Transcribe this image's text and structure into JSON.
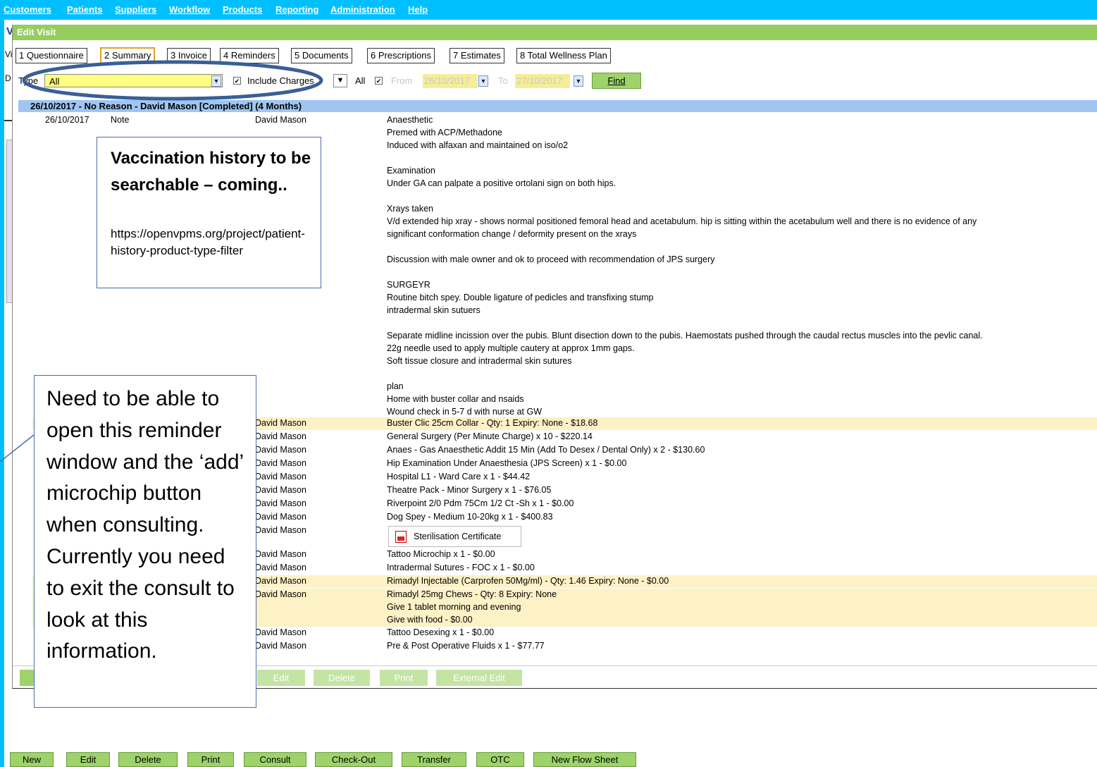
{
  "menu": [
    "Customers",
    "Patients",
    "Suppliers",
    "Workflow",
    "Products",
    "Reporting",
    "Administration",
    "Help"
  ],
  "window": {
    "title": "Edit Visit",
    "tabs": [
      "1 Questionnaire",
      "2 Summary",
      "3 Invoice",
      "4 Reminders",
      "5 Documents",
      "6 Prescriptions",
      "7 Estimates",
      "8 Total Wellness Plan"
    ],
    "filter": {
      "type_label": "Type",
      "type_value": "All",
      "include_charges_label": "Include Charges",
      "all_label": "All",
      "from_label": "From",
      "from_value": "26/10/2017",
      "to_label": "To",
      "to_value": "27/10/2017",
      "find_label": "Find"
    },
    "group_header": "26/10/2017 - No Reason - David Mason [Completed] (4 Months)",
    "first_row": {
      "date": "26/10/2017",
      "type": "Note",
      "clinician": "David Mason"
    },
    "note_lines": [
      "Anaesthetic",
      "Premed with ACP/Methadone",
      "Induced with alfaxan and maintained on iso/o2",
      "",
      "Examination",
      "Under GA can palpate a positive ortolani sign on both hips.",
      "",
      "Xrays taken",
      "V/d extended hip xray - shows normal positioned femoral head and acetabulum. hip is sitting within the acetabulum well and there is no evidence of any",
      "significant conformation change / deformity present on the xrays",
      "",
      "Discussion with male owner and ok to proceed with recommendation of JPS surgery",
      "",
      "SURGEYR",
      "Routine bitch spey. Double ligature of pedicles and transfixing stump",
      "intradermal skin sutuers",
      "",
      "Separate midline incission over the pubis. Blunt disection down to the pubis. Haemostats pushed through the caudal rectus muscles into the pevlic canal.",
      "22g needle used to apply multiple cautery at approx 1mm gaps.",
      "Soft tissue closure and intradermal skin sutures",
      "",
      "plan",
      "Home with buster collar and nsaids",
      "Wound check in 5-7 d with nurse at GW"
    ],
    "items": [
      {
        "clinician": "David Mason",
        "desc": "Buster Clic 25cm Collar - Qty: 1 Expiry: None - $18.68",
        "hl": true
      },
      {
        "clinician": "David Mason",
        "desc": "General Surgery (Per Minute Charge) x 10 - $220.14",
        "hl": false
      },
      {
        "clinician": "David Mason",
        "desc": "Anaes - Gas Anaesthetic Addit 15 Min (Add To Desex / Dental Only) x 2 - $130.60",
        "hl": false
      },
      {
        "clinician": "David Mason",
        "desc": "Hip Examination Under Anaesthesia (JPS Screen) x 1 - $0.00",
        "hl": false
      },
      {
        "clinician": "David Mason",
        "desc": "Hospital L1 - Ward Care x 1 - $44.42",
        "hl": false
      },
      {
        "clinician": "David Mason",
        "desc": "Theatre Pack - Minor Surgery x 1 - $76.05",
        "hl": false
      },
      {
        "clinician": "David Mason",
        "desc": "Riverpoint 2/0 Pdm 75Cm 1/2 Ct -Sh x 1 - $0.00",
        "hl": false
      },
      {
        "clinician": "David Mason",
        "desc": "Dog Spey - Medium 10-20kg x 1 - $400.83",
        "hl": false
      },
      {
        "clinician": "David Mason",
        "desc": "",
        "hl": false
      },
      {
        "clinician": "David Mason",
        "desc": "Tattoo Microchip x 1 - $0.00",
        "hl": false
      },
      {
        "clinician": "David Mason",
        "desc": "Intradermal Sutures - FOC x 1 - $0.00",
        "hl": false
      },
      {
        "clinician": "David Mason",
        "desc": "Rimadyl Injectable (Carprofen 50Mg/ml) - Qty: 1.46 Expiry: None - $0.00",
        "hl": true
      },
      {
        "clinician": "David Mason",
        "desc": "Rimadyl 25mg Chews - Qty: 8 Expiry: None",
        "hl": true
      },
      {
        "clinician": "",
        "desc": "Give 1 tablet morning and evening",
        "hl": true
      },
      {
        "clinician": "",
        "desc": "Give with food - $0.00",
        "hl": true
      },
      {
        "clinician": "David Mason",
        "desc": "Tattoo Desexing x 1 - $0.00",
        "hl": false
      },
      {
        "clinician": "David Mason",
        "desc": "Pre & Post Operative Fluids x 1 - $77.77",
        "hl": false
      }
    ],
    "certificate_label": "Sterilisation Certificate",
    "bottom_buttons": [
      "Edit",
      "Delete",
      "Print",
      "External Edit"
    ]
  },
  "background": {
    "left_letters": [
      "V",
      "Vi",
      "D"
    ],
    "buttons": [
      "New",
      "Edit",
      "Delete",
      "Print",
      "Consult",
      "Check-Out",
      "Transfer",
      "OTC",
      "New Flow Sheet"
    ]
  },
  "callout_vaccination": {
    "title": "Vaccination history to be searchable – coming..",
    "link": "https://openvpms.org/project/patient-history-product-type-filter"
  },
  "callout_reminder": {
    "text": "Need to be able to open this reminder window and the ‘add’ microchip button  when  consulting. Currently you need to exit the consult to look at this information."
  },
  "colors": {
    "menubar": "#00bfff",
    "titlebar": "#96cd5e",
    "group_header": "#9fc5f0",
    "highlight": "#fdf1c6",
    "type_field": "#ffff80",
    "callout_border": "#4a6ea8"
  }
}
